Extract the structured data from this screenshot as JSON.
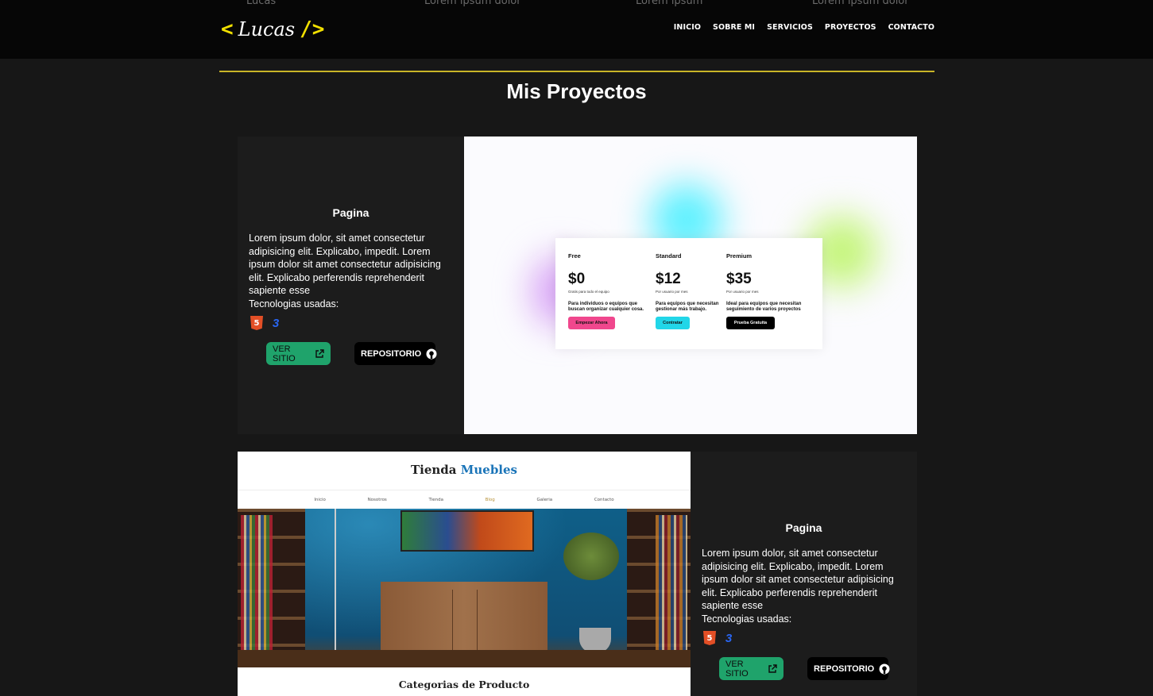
{
  "header": {
    "ghost_text": [
      "Lucas",
      "Lorem ipsum dolor",
      "Lorem ipsum",
      "Lorem ipsum dolor"
    ],
    "logo": {
      "open": "<",
      "name": "Lucas",
      "close": "/>"
    },
    "nav": [
      "INICIO",
      "SOBRE MI",
      "SERVICIOS",
      "PROYECTOS",
      "CONTACTO"
    ]
  },
  "section": {
    "title": "Mis Proyectos"
  },
  "projects": [
    {
      "title": "Pagina",
      "description": "Lorem ipsum dolor, sit amet consectetur adipisicing elit. Explicabo, impedit. Lorem ipsum dolor sit amet consectetur adipisicing elit. Explicabo perferendis reprehenderit sapiente esse",
      "tech_label": "Tecnologias usadas:",
      "techs": [
        "html5-icon",
        "css3-icon"
      ],
      "ver_label": "VER SITIO",
      "repo_label": "REPOSITORIO",
      "preview": {
        "plans": [
          {
            "name": "Free",
            "price": "$0",
            "unit": "Gratis para todo el equipo",
            "desc": "Para individuos o equipos que buscan organizar cualquier cosa.",
            "button": "Empezar Ahora",
            "color": "#f0478d"
          },
          {
            "name": "Standard",
            "price": "$12",
            "unit": "Por usuario por mes",
            "desc": "Para equipos que necesitan gestionar más trabajo.",
            "button": "Contratar",
            "color": "#22d6e8"
          },
          {
            "name": "Premium",
            "price": "$35",
            "unit": "Por usuario por mes",
            "desc": "Ideal para equipos que necesitan seguimiento de varios proyectos",
            "button": "Prueba Gratuita",
            "color": "#000000"
          }
        ]
      }
    },
    {
      "title": "Pagina",
      "description": "Lorem ipsum dolor, sit amet consectetur adipisicing elit. Explicabo, impedit. Lorem ipsum dolor sit amet consectetur adipisicing elit. Explicabo perferendis reprehenderit sapiente esse",
      "tech_label": "Tecnologias usadas:",
      "techs": [
        "html5-icon",
        "css3-icon"
      ],
      "ver_label": "VER SITIO",
      "repo_label": "REPOSITORIO",
      "preview": {
        "brand": "Tienda",
        "brand_accent": "Muebles",
        "nav": [
          "Inicio",
          "Nosotros",
          "Tienda",
          "Blog",
          "Galeria",
          "Contacto"
        ],
        "section": "Categorias de Producto"
      }
    }
  ],
  "colors": {
    "accent": "#f1e000",
    "ver_btn": "#1fa36b",
    "bg": "#171717"
  }
}
